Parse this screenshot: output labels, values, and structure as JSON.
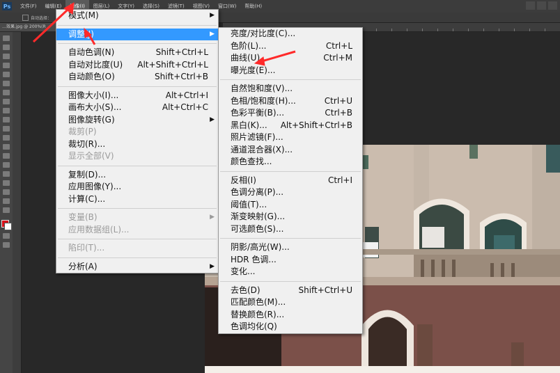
{
  "app": {
    "logo": "Ps"
  },
  "menubar": {
    "items": [
      "文件(F)",
      "编辑(E)",
      "图像(I)",
      "图层(L)",
      "文字(Y)",
      "选择(S)",
      "滤镜(T)",
      "视图(V)",
      "窗口(W)",
      "帮助(H)"
    ],
    "active_index": 2
  },
  "options_bar": {
    "auto_select": "自动选择："
  },
  "document_tab": {
    "label": "…效果.jpg @ 200%(R"
  },
  "image_menu": {
    "items": [
      {
        "label": "模式(M)",
        "shortcut": "",
        "submenu": true,
        "disabled": false
      },
      {
        "sep": true
      },
      {
        "label": "调整(J)",
        "shortcut": "",
        "submenu": true,
        "disabled": false,
        "highlighted": true
      },
      {
        "sep": true
      },
      {
        "label": "自动色调(N)",
        "shortcut": "Shift+Ctrl+L",
        "submenu": false,
        "disabled": false
      },
      {
        "label": "自动对比度(U)",
        "shortcut": "Alt+Shift+Ctrl+L",
        "submenu": false,
        "disabled": false
      },
      {
        "label": "自动颜色(O)",
        "shortcut": "Shift+Ctrl+B",
        "submenu": false,
        "disabled": false
      },
      {
        "sep": true
      },
      {
        "label": "图像大小(I)...",
        "shortcut": "Alt+Ctrl+I",
        "submenu": false,
        "disabled": false
      },
      {
        "label": "画布大小(S)...",
        "shortcut": "Alt+Ctrl+C",
        "submenu": false,
        "disabled": false
      },
      {
        "label": "图像旋转(G)",
        "shortcut": "",
        "submenu": true,
        "disabled": false
      },
      {
        "label": "裁剪(P)",
        "shortcut": "",
        "submenu": false,
        "disabled": true
      },
      {
        "label": "裁切(R)...",
        "shortcut": "",
        "submenu": false,
        "disabled": false
      },
      {
        "label": "显示全部(V)",
        "shortcut": "",
        "submenu": false,
        "disabled": true
      },
      {
        "sep": true
      },
      {
        "label": "复制(D)...",
        "shortcut": "",
        "submenu": false,
        "disabled": false
      },
      {
        "label": "应用图像(Y)...",
        "shortcut": "",
        "submenu": false,
        "disabled": false
      },
      {
        "label": "计算(C)...",
        "shortcut": "",
        "submenu": false,
        "disabled": false
      },
      {
        "sep": true
      },
      {
        "label": "变量(B)",
        "shortcut": "",
        "submenu": true,
        "disabled": true
      },
      {
        "label": "应用数据组(L)...",
        "shortcut": "",
        "submenu": false,
        "disabled": true
      },
      {
        "sep": true
      },
      {
        "label": "陷印(T)...",
        "shortcut": "",
        "submenu": false,
        "disabled": true
      },
      {
        "sep": true
      },
      {
        "label": "分析(A)",
        "shortcut": "",
        "submenu": true,
        "disabled": false
      }
    ]
  },
  "adjust_menu": {
    "items": [
      {
        "label": "亮度/对比度(C)...",
        "shortcut": ""
      },
      {
        "label": "色阶(L)...",
        "shortcut": "Ctrl+L"
      },
      {
        "label": "曲线(U)...",
        "shortcut": "Ctrl+M"
      },
      {
        "label": "曝光度(E)...",
        "shortcut": ""
      },
      {
        "sep": true
      },
      {
        "label": "自然饱和度(V)...",
        "shortcut": ""
      },
      {
        "label": "色相/饱和度(H)...",
        "shortcut": "Ctrl+U"
      },
      {
        "label": "色彩平衡(B)...",
        "shortcut": "Ctrl+B"
      },
      {
        "label": "黑白(K)...",
        "shortcut": "Alt+Shift+Ctrl+B"
      },
      {
        "label": "照片滤镜(F)...",
        "shortcut": ""
      },
      {
        "label": "通道混合器(X)...",
        "shortcut": ""
      },
      {
        "label": "颜色查找...",
        "shortcut": ""
      },
      {
        "sep": true
      },
      {
        "label": "反相(I)",
        "shortcut": "Ctrl+I"
      },
      {
        "label": "色调分离(P)...",
        "shortcut": ""
      },
      {
        "label": "阈值(T)...",
        "shortcut": ""
      },
      {
        "label": "渐变映射(G)...",
        "shortcut": ""
      },
      {
        "label": "可选颜色(S)...",
        "shortcut": ""
      },
      {
        "sep": true
      },
      {
        "label": "阴影/高光(W)...",
        "shortcut": ""
      },
      {
        "label": "HDR 色调...",
        "shortcut": ""
      },
      {
        "label": "变化...",
        "shortcut": ""
      },
      {
        "sep": true
      },
      {
        "label": "去色(D)",
        "shortcut": "Shift+Ctrl+U"
      },
      {
        "label": "匹配颜色(M)...",
        "shortcut": ""
      },
      {
        "label": "替换颜色(R)...",
        "shortcut": ""
      },
      {
        "label": "色调均化(Q)",
        "shortcut": ""
      }
    ]
  },
  "colors": {
    "highlight": "#3399ff",
    "foreground_swatch": "#d8111a",
    "background_swatch": "#ffffff",
    "annotation_arrow": "#ff2a2a"
  }
}
